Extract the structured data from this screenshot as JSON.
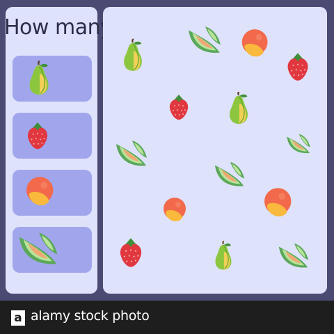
{
  "sidebar": {
    "title": "How many",
    "slots": [
      {
        "fruit": "pear-icon"
      },
      {
        "fruit": "strawberry-icon"
      },
      {
        "fruit": "peach-icon"
      },
      {
        "fruit": "melon-slice-icon"
      }
    ]
  },
  "board": {
    "fruits": [
      "pear",
      "melon",
      "peach",
      "strawberry",
      "strawberry",
      "pear",
      "melon",
      "melon",
      "melon",
      "peach",
      "peach",
      "strawberry",
      "pear",
      "melon"
    ]
  },
  "footer": {
    "logo_letter": "a",
    "brand": "alamy stock photo"
  },
  "colors": {
    "background": "#4a4a73",
    "panel": "#dfe2fb",
    "slot": "#a1a6ec",
    "footer": "#1e1e1e"
  }
}
